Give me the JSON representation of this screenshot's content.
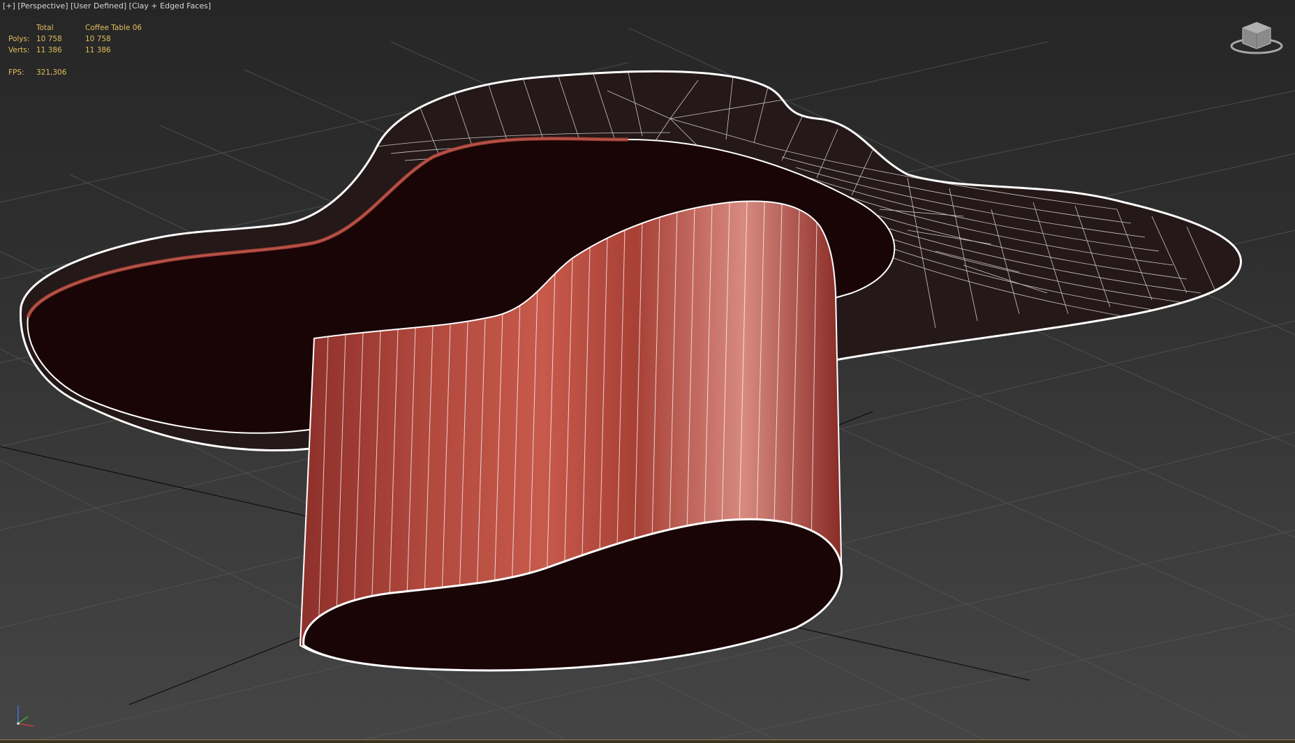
{
  "viewport": {
    "label": {
      "plus": "[+]",
      "view": "[Perspective]",
      "camera": "[User Defined]",
      "shading": "[Clay + Edged Faces]"
    },
    "stats": {
      "header_total": "Total",
      "header_object": "Coffee Table 06",
      "polys_label": "Polys:",
      "polys_total": "10 758",
      "polys_object": "10 758",
      "verts_label": "Verts:",
      "verts_total": "11 386",
      "verts_object": "11 386",
      "fps_label": "FPS:",
      "fps_value": "321,306"
    },
    "colors": {
      "stats_text": "#e2bf5b",
      "clay": "#b0453a",
      "clay_dark": "#1a0506",
      "wire": "#ffffff",
      "grid": "#555555"
    },
    "icons": {
      "viewcube": "viewcube-icon",
      "axis_tripod": "axis-tripod-icon"
    }
  }
}
